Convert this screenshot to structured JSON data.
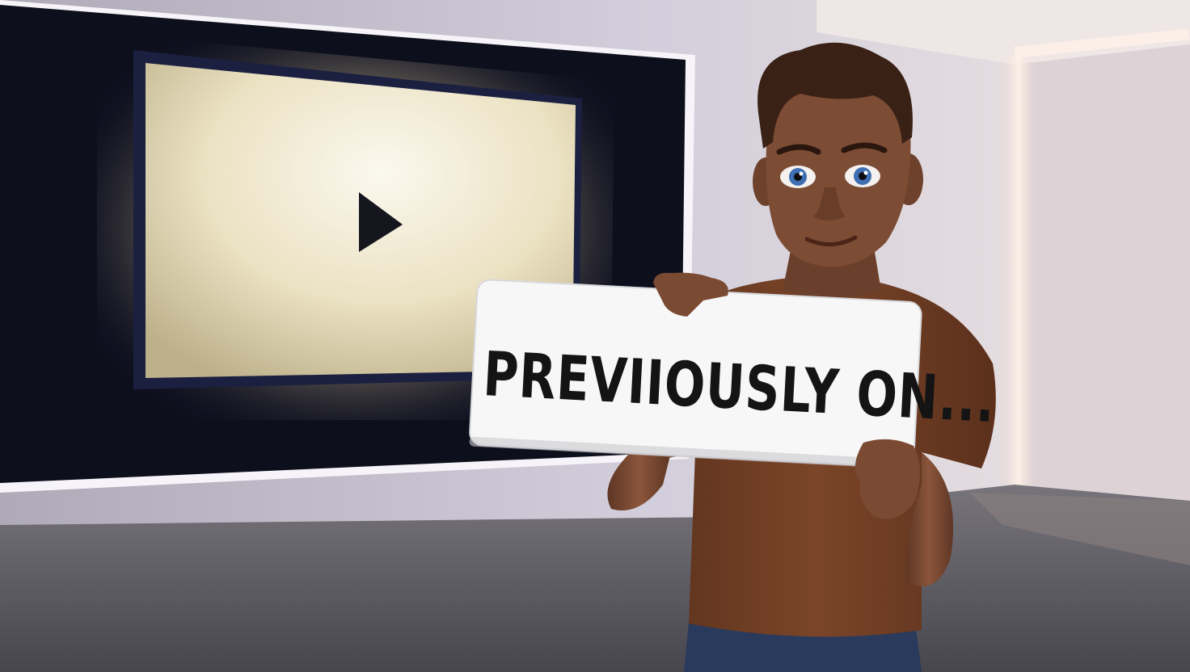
{
  "scene": {
    "sign": {
      "text": "PREVIIOUSLY ON..."
    },
    "screen": {
      "icon": "play-icon"
    },
    "colors": {
      "wall": "#c9c5d2",
      "floor": "#5a5860",
      "screen_glow": "#f2ecd2",
      "shirt": "#6e3d22",
      "skin": "#7a4a33",
      "sign": "#f7f7f7",
      "sign_text": "#141414"
    }
  }
}
